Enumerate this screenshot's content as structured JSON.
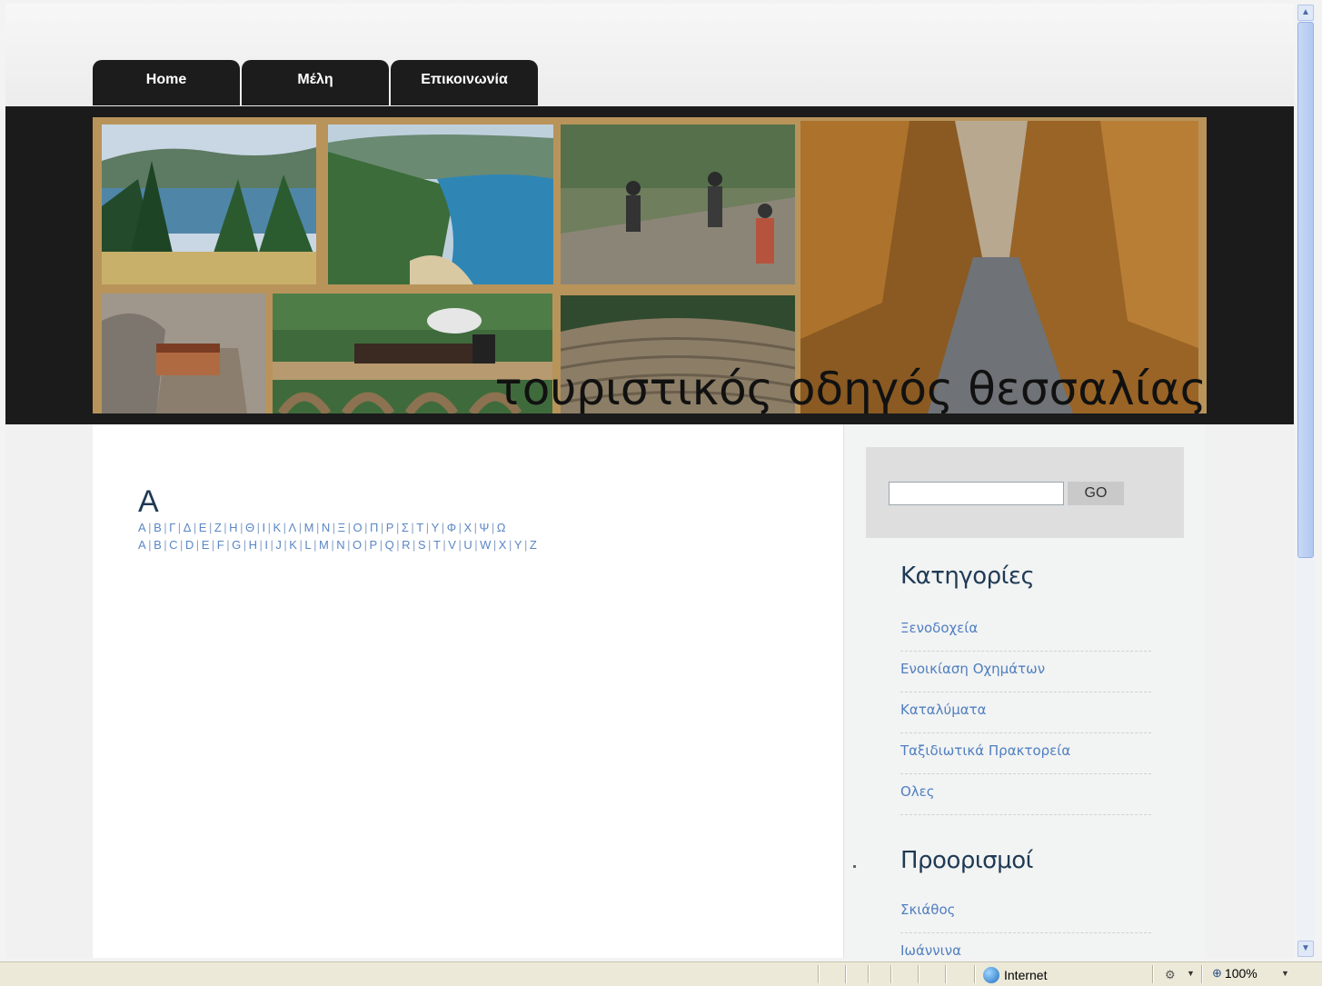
{
  "nav": {
    "tabs": [
      {
        "label": "Home"
      },
      {
        "label": "Μέλη"
      },
      {
        "label": "Επικοινωνία"
      }
    ]
  },
  "header": {
    "site_title": "τουριστικός οδηγός θεσσαλίας"
  },
  "content": {
    "letter_heading": "Α",
    "greek_letters": [
      "Α",
      "Β",
      "Γ",
      "Δ",
      "Ε",
      "Ζ",
      "Η",
      "Θ",
      "Ι",
      "Κ",
      "Λ",
      "Μ",
      "Ν",
      "Ξ",
      "Ο",
      "Π",
      "Ρ",
      "Σ",
      "Τ",
      "Υ",
      "Φ",
      "Χ",
      "Ψ",
      "Ω"
    ],
    "latin_letters": [
      "A",
      "B",
      "C",
      "D",
      "E",
      "F",
      "G",
      "H",
      "I",
      "J",
      "K",
      "L",
      "M",
      "N",
      "O",
      "P",
      "Q",
      "R",
      "S",
      "T",
      "V",
      "U",
      "W",
      "X",
      "Y",
      "Z"
    ],
    "separator": "|"
  },
  "sidebar": {
    "search": {
      "button_label": "GO",
      "value": ""
    },
    "categories_heading": "Κατηγορίες",
    "categories": [
      {
        "label": "Ξενοδοχεία"
      },
      {
        "label": "Ενοικίαση Οχημάτων"
      },
      {
        "label": "Καταλύματα"
      },
      {
        "label": "Ταξιδιωτικά Πρακτορεία"
      },
      {
        "label": "Ολες"
      }
    ],
    "destinations_heading": "Προορισμοί",
    "destinations": [
      {
        "label": "Σκιάθος"
      },
      {
        "label": "Ιωάννινα"
      }
    ]
  },
  "statusbar": {
    "zone": "Internet",
    "zoom": "100%"
  },
  "colors": {
    "tab_bg": "#1c1c1c",
    "link": "#4f7fc0",
    "heading": "#1f3a55",
    "banner_frame": "#b8945a"
  }
}
